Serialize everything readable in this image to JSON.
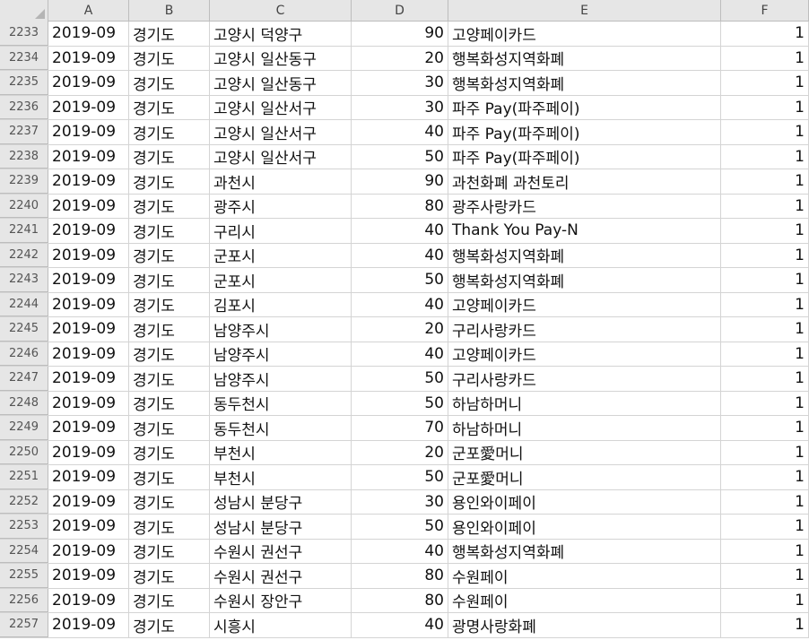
{
  "columns": [
    "A",
    "B",
    "C",
    "D",
    "E",
    "F"
  ],
  "rows": [
    {
      "num": "2233",
      "cells": [
        "2019-09",
        "경기도",
        "고양시 덕양구",
        "90",
        "고양페이카드",
        "1"
      ]
    },
    {
      "num": "2234",
      "cells": [
        "2019-09",
        "경기도",
        "고양시 일산동구",
        "20",
        "행복화성지역화폐",
        "1"
      ]
    },
    {
      "num": "2235",
      "cells": [
        "2019-09",
        "경기도",
        "고양시 일산동구",
        "30",
        "행복화성지역화폐",
        "1"
      ]
    },
    {
      "num": "2236",
      "cells": [
        "2019-09",
        "경기도",
        "고양시 일산서구",
        "30",
        "파주 Pay(파주페이)",
        "1"
      ]
    },
    {
      "num": "2237",
      "cells": [
        "2019-09",
        "경기도",
        "고양시 일산서구",
        "40",
        "파주 Pay(파주페이)",
        "1"
      ]
    },
    {
      "num": "2238",
      "cells": [
        "2019-09",
        "경기도",
        "고양시 일산서구",
        "50",
        "파주 Pay(파주페이)",
        "1"
      ]
    },
    {
      "num": "2239",
      "cells": [
        "2019-09",
        "경기도",
        "과천시",
        "90",
        "과천화폐 과천토리",
        "1"
      ]
    },
    {
      "num": "2240",
      "cells": [
        "2019-09",
        "경기도",
        "광주시",
        "80",
        "광주사랑카드",
        "1"
      ]
    },
    {
      "num": "2241",
      "cells": [
        "2019-09",
        "경기도",
        "구리시",
        "40",
        "Thank You Pay-N",
        "1"
      ]
    },
    {
      "num": "2242",
      "cells": [
        "2019-09",
        "경기도",
        "군포시",
        "40",
        "행복화성지역화폐",
        "1"
      ]
    },
    {
      "num": "2243",
      "cells": [
        "2019-09",
        "경기도",
        "군포시",
        "50",
        "행복화성지역화폐",
        "1"
      ]
    },
    {
      "num": "2244",
      "cells": [
        "2019-09",
        "경기도",
        "김포시",
        "40",
        "고양페이카드",
        "1"
      ]
    },
    {
      "num": "2245",
      "cells": [
        "2019-09",
        "경기도",
        "남양주시",
        "20",
        "구리사랑카드",
        "1"
      ]
    },
    {
      "num": "2246",
      "cells": [
        "2019-09",
        "경기도",
        "남양주시",
        "40",
        "고양페이카드",
        "1"
      ]
    },
    {
      "num": "2247",
      "cells": [
        "2019-09",
        "경기도",
        "남양주시",
        "50",
        "구리사랑카드",
        "1"
      ]
    },
    {
      "num": "2248",
      "cells": [
        "2019-09",
        "경기도",
        "동두천시",
        "50",
        "하남하머니",
        "1"
      ]
    },
    {
      "num": "2249",
      "cells": [
        "2019-09",
        "경기도",
        "동두천시",
        "70",
        "하남하머니",
        "1"
      ]
    },
    {
      "num": "2250",
      "cells": [
        "2019-09",
        "경기도",
        "부천시",
        "20",
        "군포愛머니",
        "1"
      ]
    },
    {
      "num": "2251",
      "cells": [
        "2019-09",
        "경기도",
        "부천시",
        "50",
        "군포愛머니",
        "1"
      ]
    },
    {
      "num": "2252",
      "cells": [
        "2019-09",
        "경기도",
        "성남시 분당구",
        "30",
        "용인와이페이",
        "1"
      ]
    },
    {
      "num": "2253",
      "cells": [
        "2019-09",
        "경기도",
        "성남시 분당구",
        "50",
        "용인와이페이",
        "1"
      ]
    },
    {
      "num": "2254",
      "cells": [
        "2019-09",
        "경기도",
        "수원시 권선구",
        "40",
        "행복화성지역화폐",
        "1"
      ]
    },
    {
      "num": "2255",
      "cells": [
        "2019-09",
        "경기도",
        "수원시 권선구",
        "80",
        "수원페이",
        "1"
      ]
    },
    {
      "num": "2256",
      "cells": [
        "2019-09",
        "경기도",
        "수원시 장안구",
        "80",
        "수원페이",
        "1"
      ]
    },
    {
      "num": "2257",
      "cells": [
        "2019-09",
        "경기도",
        "시흥시",
        "40",
        "광명사랑화폐",
        "1"
      ]
    }
  ]
}
